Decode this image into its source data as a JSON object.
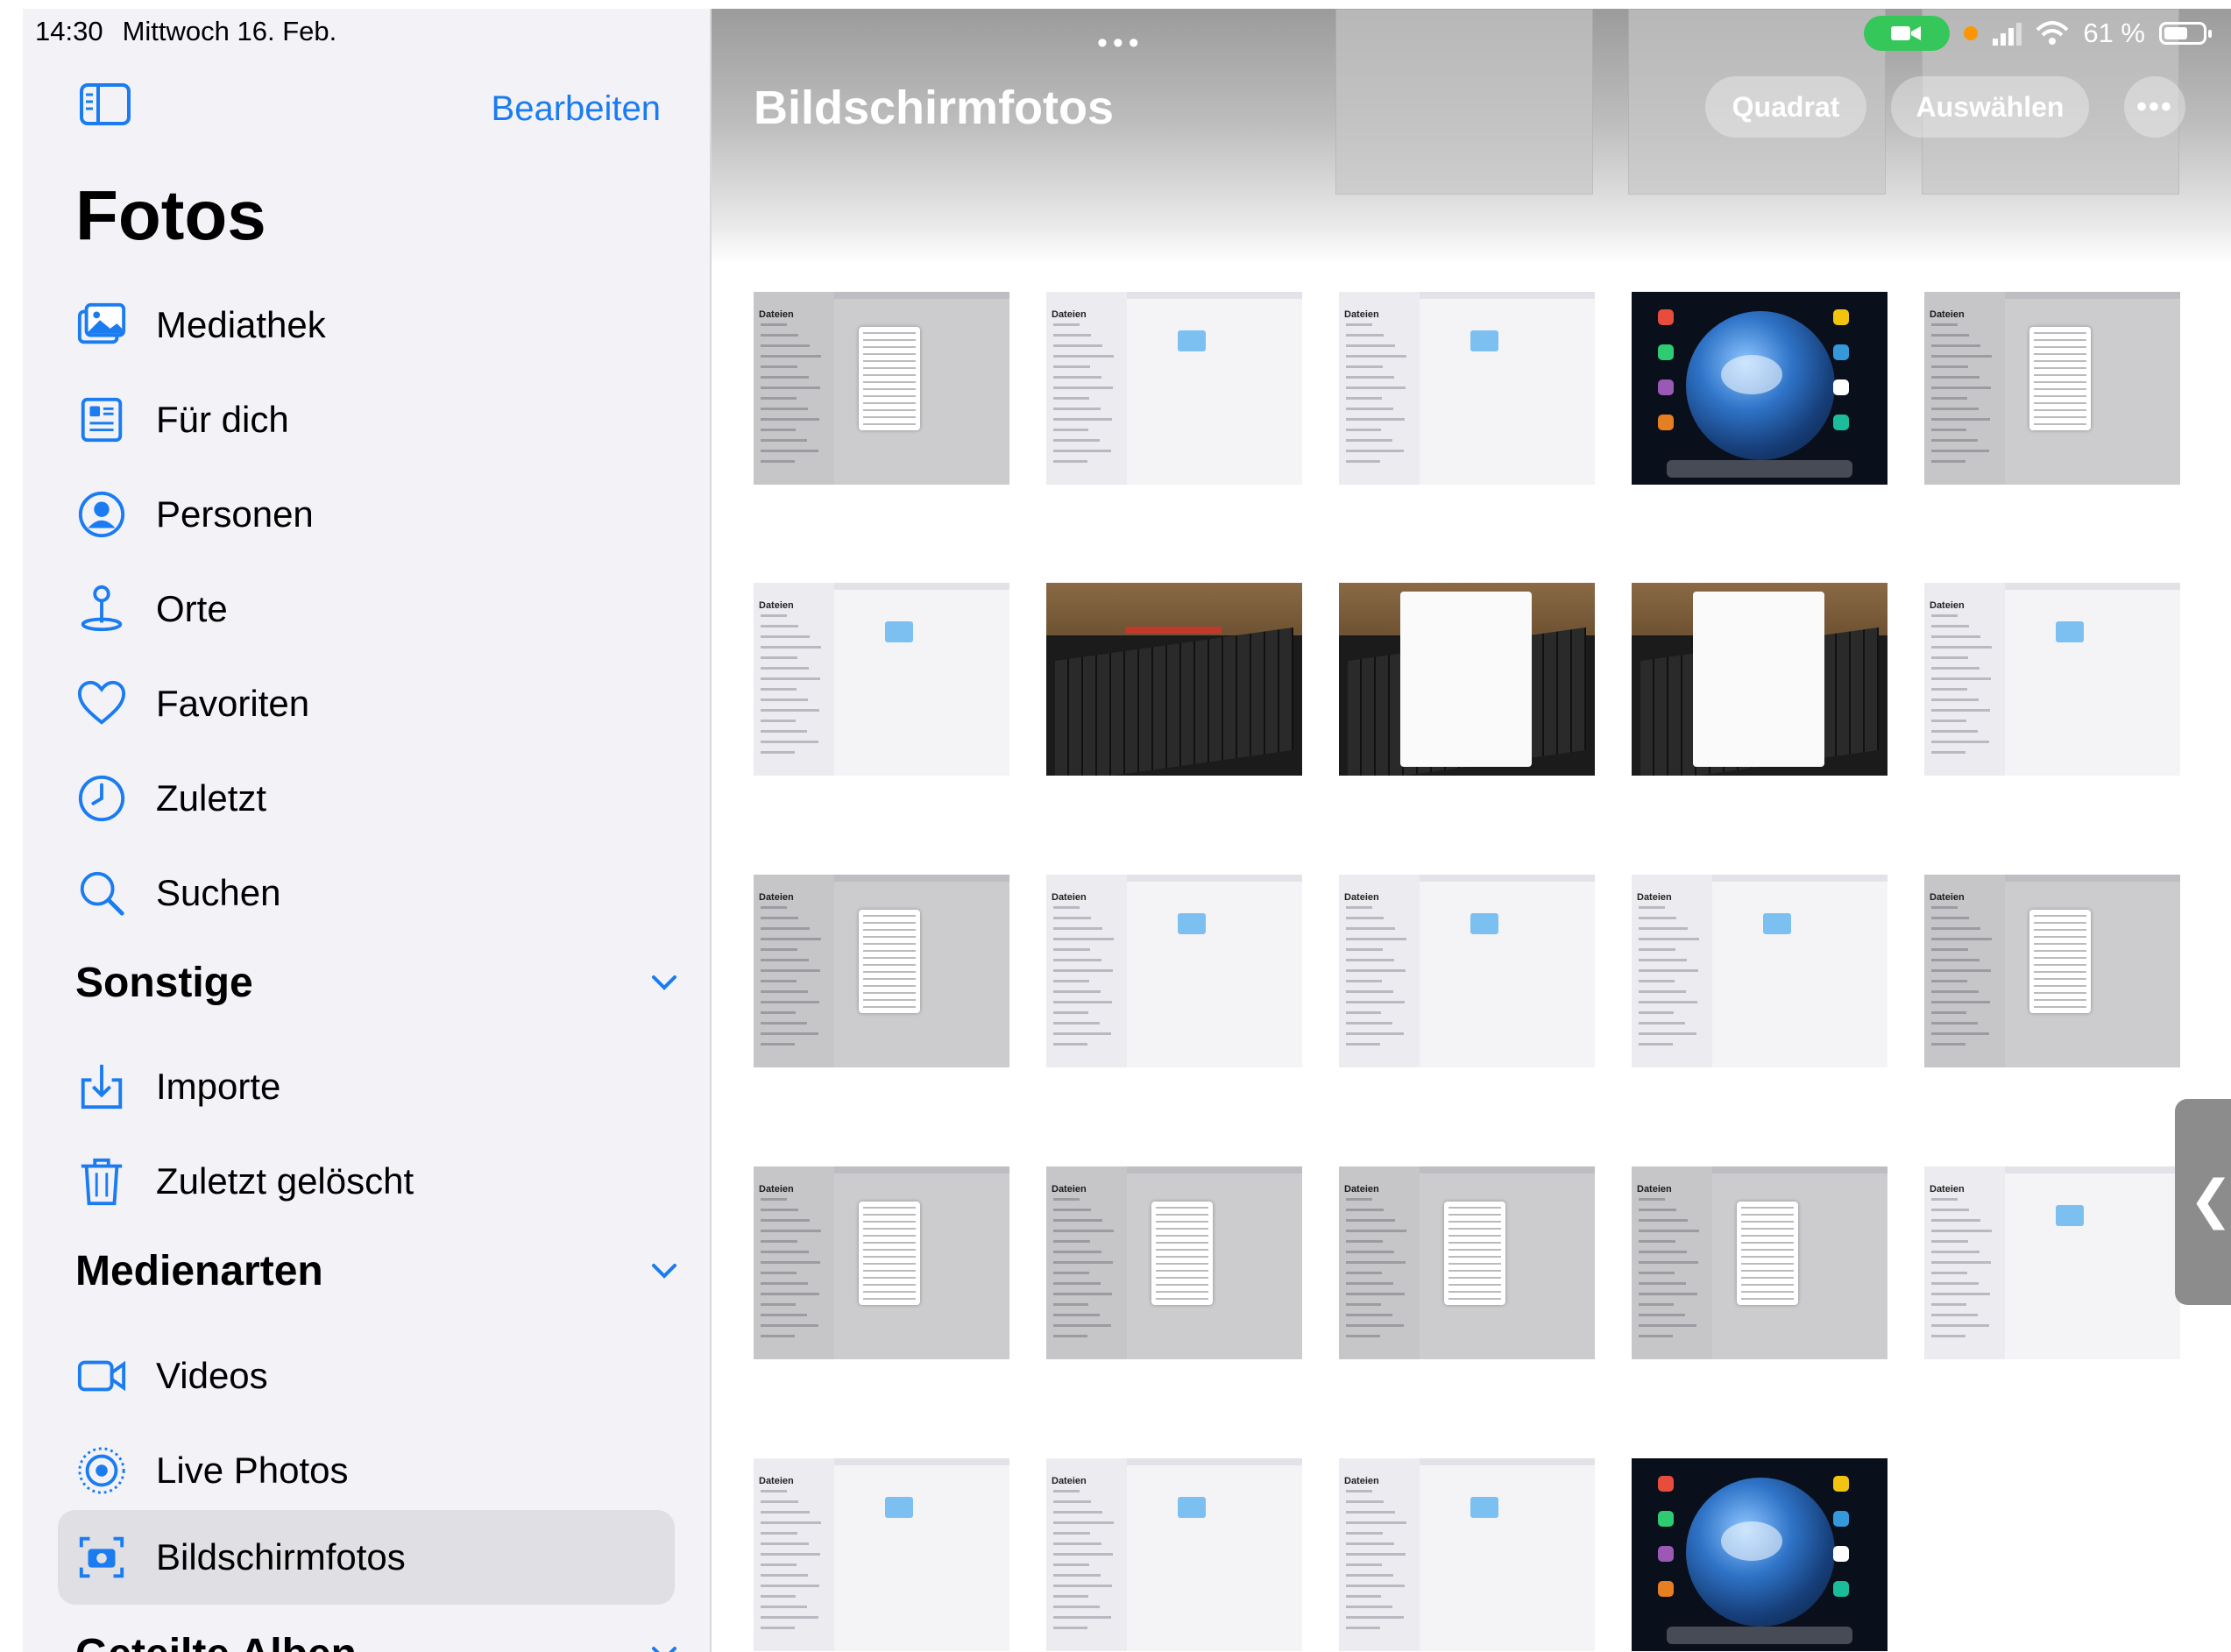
{
  "status_bar": {
    "time": "14:30",
    "date": "Mittwoch 16. Feb.",
    "battery_percent": "61 %",
    "battery_level": 0.61
  },
  "sidebar": {
    "edit_label": "Bearbeiten",
    "title": "Fotos",
    "items": [
      {
        "label": "Mediathek",
        "icon": "photo-library-icon"
      },
      {
        "label": "Für dich",
        "icon": "for-you-icon"
      },
      {
        "label": "Personen",
        "icon": "person-circle-icon"
      },
      {
        "label": "Orte",
        "icon": "map-pin-icon"
      },
      {
        "label": "Favoriten",
        "icon": "heart-icon"
      },
      {
        "label": "Zuletzt",
        "icon": "clock-icon"
      },
      {
        "label": "Suchen",
        "icon": "search-icon"
      }
    ],
    "sections": [
      {
        "title": "Sonstige",
        "items": [
          {
            "label": "Importe",
            "icon": "import-icon"
          },
          {
            "label": "Zuletzt gelöscht",
            "icon": "trash-icon"
          }
        ]
      },
      {
        "title": "Medienarten",
        "items": [
          {
            "label": "Videos",
            "icon": "video-icon"
          },
          {
            "label": "Live Photos",
            "icon": "live-photo-icon"
          },
          {
            "label": "Bildschirmfotos",
            "icon": "screenshot-icon",
            "selected": true
          }
        ]
      },
      {
        "title": "Geteilte Alben",
        "items": []
      }
    ]
  },
  "main": {
    "title": "Bildschirmfotos",
    "buttons": {
      "aspect": "Quadrat",
      "select": "Auswählen",
      "more": "•••"
    },
    "thumbnails": [
      {
        "kind": "files-menu"
      },
      {
        "kind": "files"
      },
      {
        "kind": "files"
      },
      {
        "kind": "home"
      },
      {
        "kind": "files-menu"
      },
      {
        "kind": "files"
      },
      {
        "kind": "photo"
      },
      {
        "kind": "photo-menu"
      },
      {
        "kind": "photo-menu"
      },
      {
        "kind": "files"
      },
      {
        "kind": "files-menu"
      },
      {
        "kind": "files"
      },
      {
        "kind": "files"
      },
      {
        "kind": "files"
      },
      {
        "kind": "files-menu"
      },
      {
        "kind": "files-menu"
      },
      {
        "kind": "files-menu"
      },
      {
        "kind": "files-menu"
      },
      {
        "kind": "files-menu"
      },
      {
        "kind": "files"
      },
      {
        "kind": "files"
      },
      {
        "kind": "files"
      },
      {
        "kind": "files"
      },
      {
        "kind": "home"
      }
    ]
  },
  "colors": {
    "accent": "#1a7cf0",
    "sidebar_bg": "#f2f2f7",
    "selected_bg": "#dfdfe4",
    "facetime_green": "#35c759"
  }
}
